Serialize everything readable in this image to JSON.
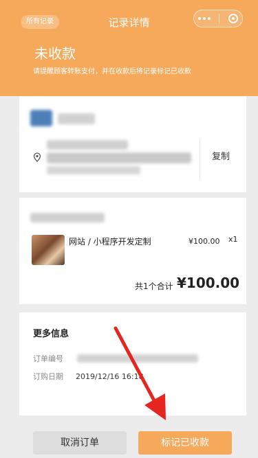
{
  "nav": {
    "back_label": "所有记录",
    "title": "记录详情"
  },
  "status": {
    "title": "未收款",
    "hint": "请提醒顾客转账支付，并在收款后将记录标记已收款"
  },
  "address": {
    "copy_label": "复制"
  },
  "product": {
    "name": "网站 / 小程序开发定制",
    "price": "¥100.00",
    "qty": "x1"
  },
  "total": {
    "label": "共1个合计",
    "value": "¥100.00"
  },
  "more": {
    "title": "更多信息",
    "order_no_label": "订单编号",
    "date_label": "订购日期",
    "date_value": "2019/12/16 16:18"
  },
  "footer": {
    "cancel_label": "取消订单",
    "mark_paid_label": "标记已收款"
  },
  "colors": {
    "accent": "#f6a95b",
    "annotation_arrow": "#e5251f"
  },
  "icons": [
    "more-dots-icon",
    "close-ring-icon",
    "location-pin-icon"
  ]
}
